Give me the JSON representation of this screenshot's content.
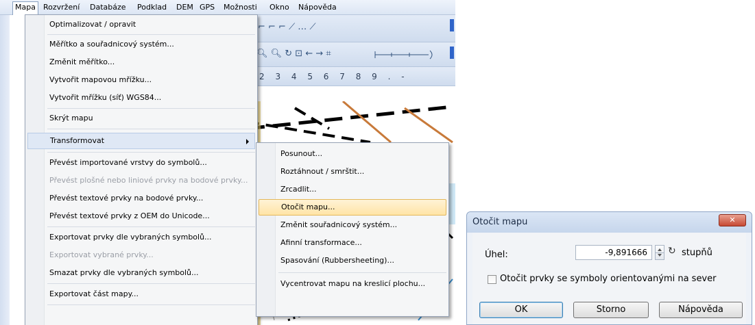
{
  "menubar": {
    "items": [
      "Mapa",
      "Rozvržení",
      "Databáze",
      "Podklad",
      "DEM",
      "GPS",
      "Možnosti",
      "Okno",
      "Nápověda"
    ]
  },
  "toolbar": {
    "digits": "2 3 4 5 6 7 8 9 . -"
  },
  "mapa_menu": {
    "items": [
      {
        "label": "Optimalizovat / opravit",
        "disabled": false
      },
      {
        "label": "Měřítko a souřadnicový systém...",
        "disabled": false
      },
      {
        "label": "Změnit měřítko...",
        "disabled": false
      },
      {
        "label": "Vytvořit mapovou mřížku...",
        "disabled": false
      },
      {
        "label": "Vytvořit mřížku (síť) WGS84...",
        "disabled": false
      },
      {
        "label": "Skrýt mapu",
        "disabled": false
      },
      {
        "label": "Transformovat",
        "disabled": false
      },
      {
        "label": "Převést importované vrstvy do symbolů...",
        "disabled": false
      },
      {
        "label": "Převést plošné nebo liniové prvky na bodové prvky...",
        "disabled": true
      },
      {
        "label": "Převést textové prvky na bodové prvky...",
        "disabled": false
      },
      {
        "label": "Převést textové prvky z OEM do Unicode...",
        "disabled": false
      },
      {
        "label": "Exportovat prvky dle vybraných symbolů...",
        "disabled": false
      },
      {
        "label": "Exportovat vybrané prvky...",
        "disabled": true
      },
      {
        "label": "Smazat prvky dle vybraných symbolů...",
        "disabled": false
      },
      {
        "label": "Exportovat část mapy...",
        "disabled": false
      }
    ]
  },
  "transform_menu": {
    "items": [
      "Posunout...",
      "Roztáhnout / smrštit...",
      "Zrcadlit...",
      "Otočit mapu...",
      "Změnit souřadnicový systém...",
      "Afinní transformace...",
      "Spasování (Rubbersheeting)...",
      "Vycentrovat mapu na kreslicí plochu..."
    ],
    "highlighted": "Otočit mapu..."
  },
  "dialog": {
    "title": "Otočit mapu",
    "close_label": "✕",
    "angle_label": "Úhel:",
    "angle_value": "-9,891666",
    "unit_label": "stupňů",
    "checkbox_label": "Otočit prvky se symboly orientovanými na sever",
    "checkbox_checked": false,
    "ok_label": "OK",
    "cancel_label": "Storno",
    "help_label": "Nápověda"
  },
  "icons": {
    "rotate": "rotate-clockwise-icon",
    "close": "close-icon",
    "submenu": "chevron-right-icon"
  },
  "colors": {
    "highlight": "#ffe4a6",
    "dialog_close": "#c64933",
    "menubar": "#dce6f4"
  }
}
